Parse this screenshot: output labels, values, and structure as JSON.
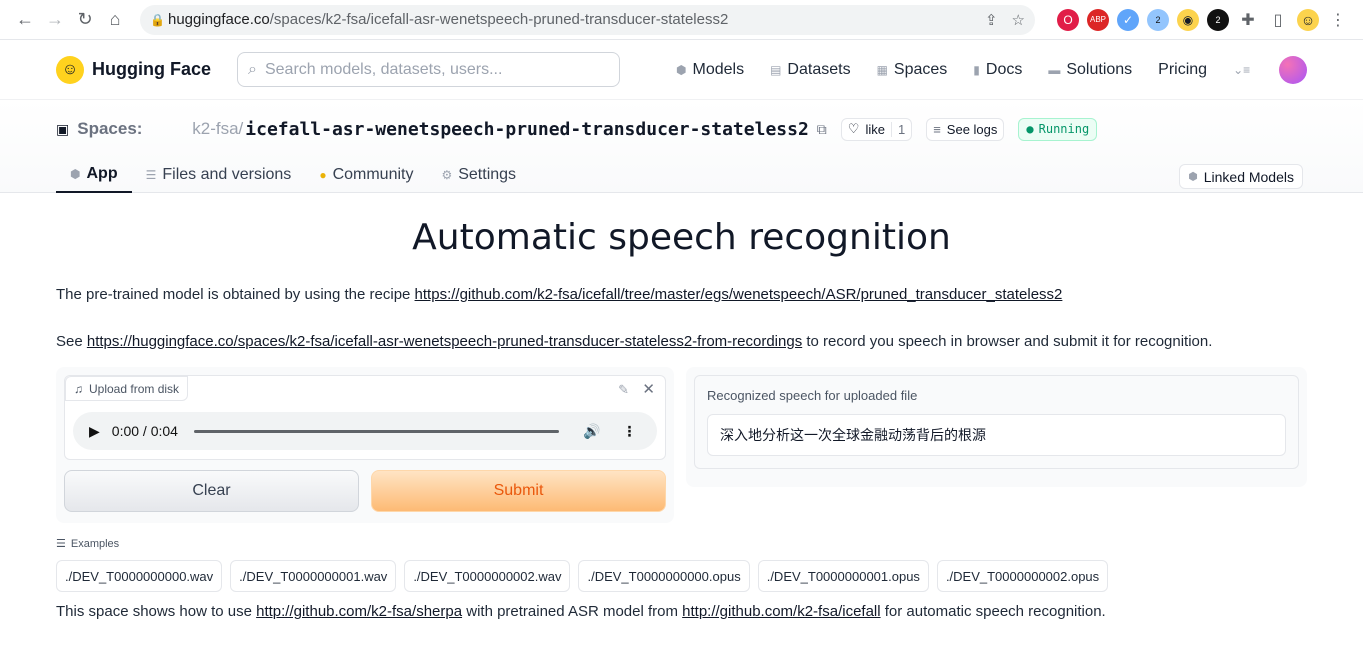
{
  "browser": {
    "url_host": "huggingface.co",
    "url_path": "/spaces/k2-fsa/icefall-asr-wenetspeech-pruned-transducer-stateless2",
    "ext_badge_1": "2",
    "ext_badge_2": "2"
  },
  "header": {
    "brand": "Hugging Face",
    "search_placeholder": "Search models, datasets, users...",
    "nav": [
      "Models",
      "Datasets",
      "Spaces",
      "Docs",
      "Solutions",
      "Pricing"
    ]
  },
  "space": {
    "section": "Spaces:",
    "org": "k2-fsa",
    "separator": "/",
    "repo": "icefall-asr-wenetspeech-pruned-transducer-stateless2",
    "like_label": "like",
    "like_count": "1",
    "logs_label": "See logs",
    "status": "Running",
    "tabs": [
      "App",
      "Files and versions",
      "Community",
      "Settings"
    ],
    "linked_models": "Linked Models"
  },
  "app": {
    "title": "Automatic speech recognition",
    "intro_prefix": "The pre-trained model is obtained by using the recipe ",
    "intro_link": "https://github.com/k2-fsa/icefall/tree/master/egs/wenetspeech/ASR/pruned_transducer_stateless2",
    "see_prefix": "See ",
    "see_link": "https://huggingface.co/spaces/k2-fsa/icefall-asr-wenetspeech-pruned-transducer-stateless2-from-recordings",
    "see_suffix": " to record you speech in browser and submit it for recognition.",
    "upload_label": "Upload from disk",
    "player_time": "0:00 / 0:04",
    "clear_label": "Clear",
    "submit_label": "Submit",
    "output_label": "Recognized speech for uploaded file",
    "output_value": "深入地分析这一次全球金融动荡背后的根源",
    "examples_label": "Examples",
    "examples": [
      "./DEV_T0000000000.wav",
      "./DEV_T0000000001.wav",
      "./DEV_T0000000002.wav",
      "./DEV_T0000000000.opus",
      "./DEV_T0000000001.opus",
      "./DEV_T0000000002.opus"
    ],
    "footer_prefix": "This space shows how to use ",
    "footer_link1": "http://github.com/k2-fsa/sherpa",
    "footer_mid": " with pretrained ASR model from ",
    "footer_link2": "http://github.com/k2-fsa/icefall",
    "footer_suffix": " for automatic speech recognition."
  }
}
